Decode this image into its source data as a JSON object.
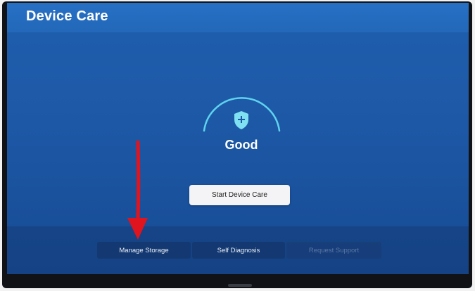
{
  "header": {
    "title": "Device Care"
  },
  "status": {
    "label": "Good",
    "icon": "shield-plus-icon"
  },
  "actions": {
    "start_label": "Start Device Care"
  },
  "bottom_menu": {
    "items": [
      {
        "label": "Manage Storage",
        "enabled": true
      },
      {
        "label": "Self Diagnosis",
        "enabled": true
      },
      {
        "label": "Request Support",
        "enabled": false
      }
    ]
  },
  "annotation": {
    "icon": "red-arrow-icon"
  },
  "colors": {
    "screen_blue": "#1d58a6",
    "header_blue": "#2670c4",
    "arc_cyan": "#5fd3ee",
    "shield_cyan": "#7fe0f2",
    "button_light": "#f4f4f6",
    "annotation_red": "#e0141e"
  }
}
